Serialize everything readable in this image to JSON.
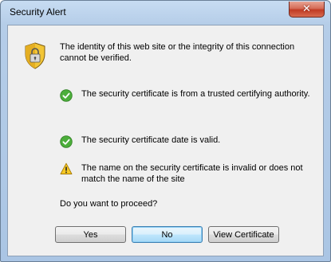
{
  "window": {
    "title": "Security Alert"
  },
  "titlebar": {
    "close_glyph": "✕"
  },
  "message": {
    "intro": "The identity of this web site or the integrity of this connection cannot be verified.",
    "icon": "security-shield-lock-icon"
  },
  "checks": [
    {
      "text": "The security certificate is from a trusted certifying authority.",
      "status": "ok"
    },
    {
      "text": "The security certificate date is valid.",
      "status": "ok"
    },
    {
      "text": "The name on the security certificate is invalid or does not match the name of the site",
      "status": "warning"
    }
  ],
  "question": "Do you want to proceed?",
  "buttons": {
    "yes": "Yes",
    "no": "No",
    "view": "View Certificate"
  },
  "colors": {
    "ok": "#3aa12f",
    "warning": "#f5c518",
    "focus": "#3c7fb1"
  }
}
